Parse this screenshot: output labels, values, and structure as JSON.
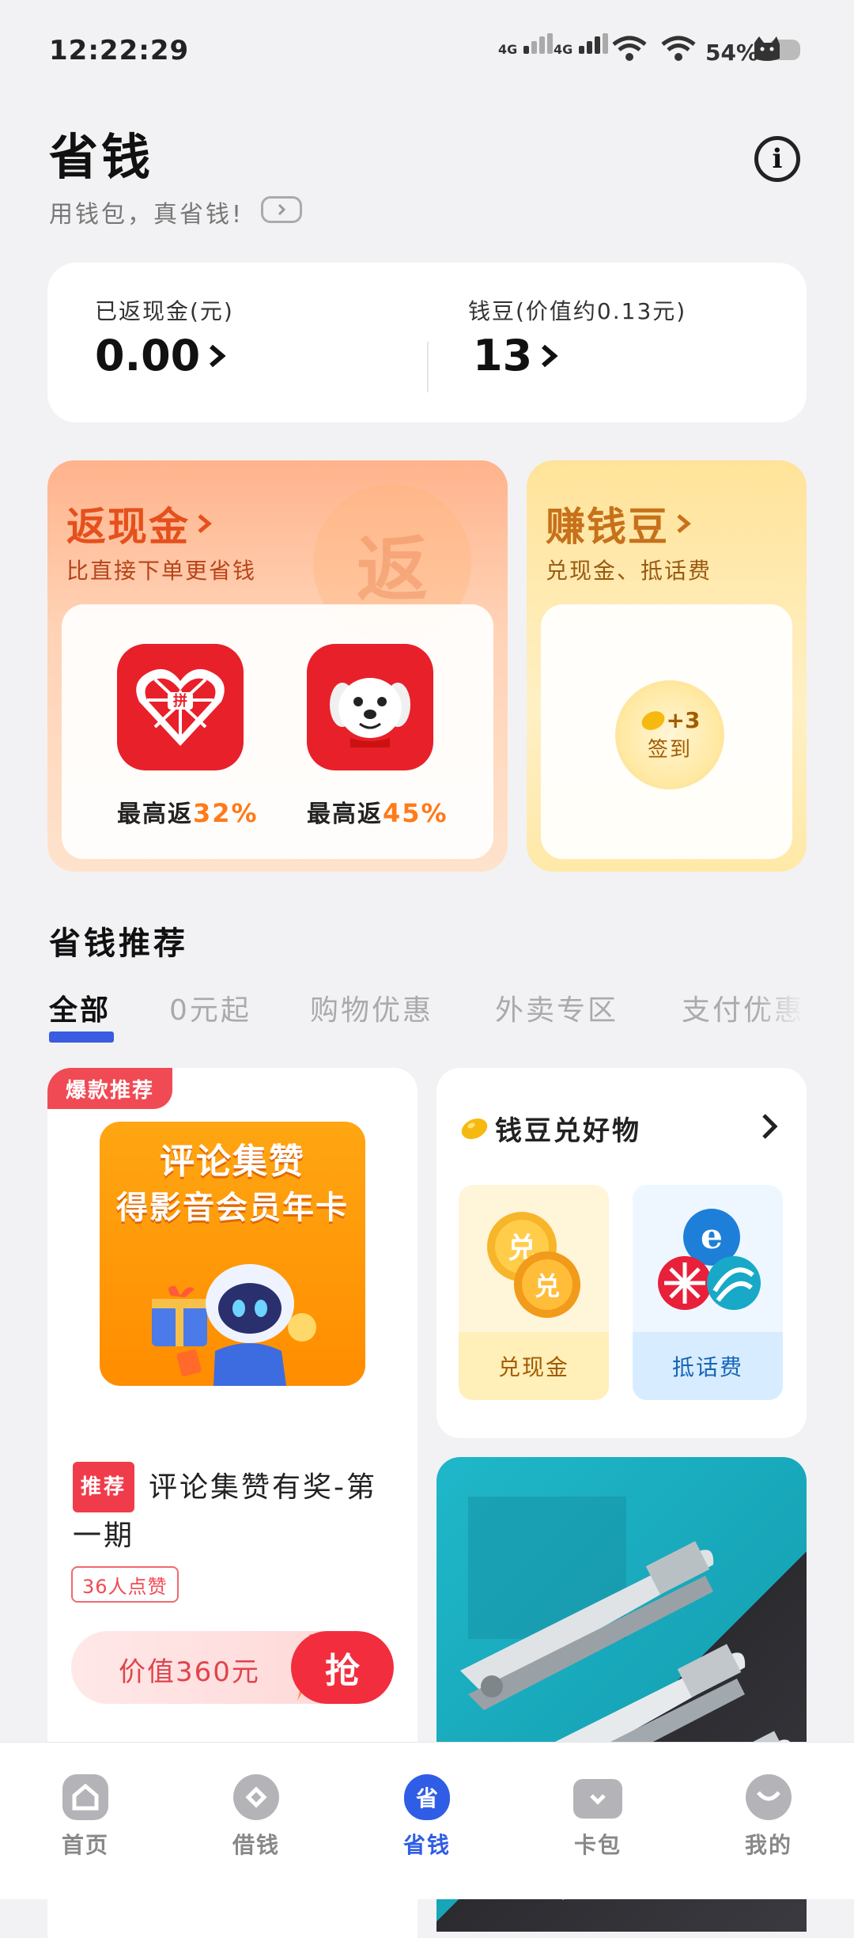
{
  "status_bar": {
    "time": "12:22:29",
    "sim1": "4G",
    "sim2": "4G",
    "battery": "54%"
  },
  "header": {
    "title": "省钱",
    "subtitle": "用钱包，真省钱!"
  },
  "balance": {
    "cashback_label": "已返现金(元)",
    "cashback_value": "0.00",
    "beans_label": "钱豆(价值约0.13元)",
    "beans_value": "13"
  },
  "cashback_card": {
    "title": "返现金",
    "subtitle": "比直接下单更省钱",
    "watermark": "返",
    "apps": [
      {
        "prefix": "最高返",
        "percent": "32%"
      },
      {
        "prefix": "最高返",
        "percent": "45%"
      }
    ]
  },
  "beans_card": {
    "title": "赚钱豆",
    "subtitle": "兑现金、抵话费",
    "checkin_bonus": "+3",
    "checkin_label": "签到"
  },
  "recommend": {
    "title": "省钱推荐",
    "tabs": [
      "全部",
      "0元起",
      "购物优惠",
      "外卖专区",
      "支付优惠"
    ]
  },
  "feed_left": {
    "hot_tag": "爆款推荐",
    "promo_line1": "评论集赞",
    "promo_line2": "得影音会员年卡",
    "badge": "推荐",
    "title": "评论集赞有奖-第一期",
    "likes": "36人点赞",
    "value": "价值360元",
    "grab": "抢"
  },
  "feed_right": {
    "title": "钱豆兑好物",
    "cash_coin1": "兑",
    "cash_coin2": "兑",
    "cash_label": "兑现金",
    "phone_label": "抵话费"
  },
  "nav": {
    "items": [
      "首页",
      "借钱",
      "省钱",
      "卡包",
      "我的"
    ],
    "active_icon_text": "省"
  },
  "colors": {
    "accent": "#2f5de6",
    "red": "#f22e3e",
    "orange": "#ff7a1a"
  }
}
